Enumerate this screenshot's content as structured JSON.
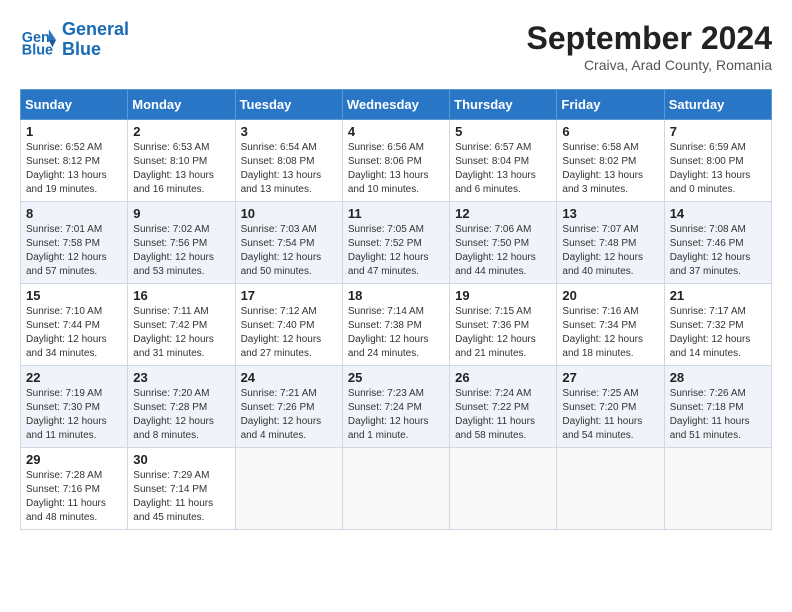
{
  "header": {
    "logo_line1": "General",
    "logo_line2": "Blue",
    "month": "September 2024",
    "location": "Craiva, Arad County, Romania"
  },
  "columns": [
    "Sunday",
    "Monday",
    "Tuesday",
    "Wednesday",
    "Thursday",
    "Friday",
    "Saturday"
  ],
  "weeks": [
    [
      {
        "day": 1,
        "sunrise": "6:52 AM",
        "sunset": "8:12 PM",
        "daylight": "13 hours and 19 minutes."
      },
      {
        "day": 2,
        "sunrise": "6:53 AM",
        "sunset": "8:10 PM",
        "daylight": "13 hours and 16 minutes."
      },
      {
        "day": 3,
        "sunrise": "6:54 AM",
        "sunset": "8:08 PM",
        "daylight": "13 hours and 13 minutes."
      },
      {
        "day": 4,
        "sunrise": "6:56 AM",
        "sunset": "8:06 PM",
        "daylight": "13 hours and 10 minutes."
      },
      {
        "day": 5,
        "sunrise": "6:57 AM",
        "sunset": "8:04 PM",
        "daylight": "13 hours and 6 minutes."
      },
      {
        "day": 6,
        "sunrise": "6:58 AM",
        "sunset": "8:02 PM",
        "daylight": "13 hours and 3 minutes."
      },
      {
        "day": 7,
        "sunrise": "6:59 AM",
        "sunset": "8:00 PM",
        "daylight": "13 hours and 0 minutes."
      }
    ],
    [
      {
        "day": 8,
        "sunrise": "7:01 AM",
        "sunset": "7:58 PM",
        "daylight": "12 hours and 57 minutes."
      },
      {
        "day": 9,
        "sunrise": "7:02 AM",
        "sunset": "7:56 PM",
        "daylight": "12 hours and 53 minutes."
      },
      {
        "day": 10,
        "sunrise": "7:03 AM",
        "sunset": "7:54 PM",
        "daylight": "12 hours and 50 minutes."
      },
      {
        "day": 11,
        "sunrise": "7:05 AM",
        "sunset": "7:52 PM",
        "daylight": "12 hours and 47 minutes."
      },
      {
        "day": 12,
        "sunrise": "7:06 AM",
        "sunset": "7:50 PM",
        "daylight": "12 hours and 44 minutes."
      },
      {
        "day": 13,
        "sunrise": "7:07 AM",
        "sunset": "7:48 PM",
        "daylight": "12 hours and 40 minutes."
      },
      {
        "day": 14,
        "sunrise": "7:08 AM",
        "sunset": "7:46 PM",
        "daylight": "12 hours and 37 minutes."
      }
    ],
    [
      {
        "day": 15,
        "sunrise": "7:10 AM",
        "sunset": "7:44 PM",
        "daylight": "12 hours and 34 minutes."
      },
      {
        "day": 16,
        "sunrise": "7:11 AM",
        "sunset": "7:42 PM",
        "daylight": "12 hours and 31 minutes."
      },
      {
        "day": 17,
        "sunrise": "7:12 AM",
        "sunset": "7:40 PM",
        "daylight": "12 hours and 27 minutes."
      },
      {
        "day": 18,
        "sunrise": "7:14 AM",
        "sunset": "7:38 PM",
        "daylight": "12 hours and 24 minutes."
      },
      {
        "day": 19,
        "sunrise": "7:15 AM",
        "sunset": "7:36 PM",
        "daylight": "12 hours and 21 minutes."
      },
      {
        "day": 20,
        "sunrise": "7:16 AM",
        "sunset": "7:34 PM",
        "daylight": "12 hours and 18 minutes."
      },
      {
        "day": 21,
        "sunrise": "7:17 AM",
        "sunset": "7:32 PM",
        "daylight": "12 hours and 14 minutes."
      }
    ],
    [
      {
        "day": 22,
        "sunrise": "7:19 AM",
        "sunset": "7:30 PM",
        "daylight": "12 hours and 11 minutes."
      },
      {
        "day": 23,
        "sunrise": "7:20 AM",
        "sunset": "7:28 PM",
        "daylight": "12 hours and 8 minutes."
      },
      {
        "day": 24,
        "sunrise": "7:21 AM",
        "sunset": "7:26 PM",
        "daylight": "12 hours and 4 minutes."
      },
      {
        "day": 25,
        "sunrise": "7:23 AM",
        "sunset": "7:24 PM",
        "daylight": "12 hours and 1 minute."
      },
      {
        "day": 26,
        "sunrise": "7:24 AM",
        "sunset": "7:22 PM",
        "daylight": "11 hours and 58 minutes."
      },
      {
        "day": 27,
        "sunrise": "7:25 AM",
        "sunset": "7:20 PM",
        "daylight": "11 hours and 54 minutes."
      },
      {
        "day": 28,
        "sunrise": "7:26 AM",
        "sunset": "7:18 PM",
        "daylight": "11 hours and 51 minutes."
      }
    ],
    [
      {
        "day": 29,
        "sunrise": "7:28 AM",
        "sunset": "7:16 PM",
        "daylight": "11 hours and 48 minutes."
      },
      {
        "day": 30,
        "sunrise": "7:29 AM",
        "sunset": "7:14 PM",
        "daylight": "11 hours and 45 minutes."
      },
      null,
      null,
      null,
      null,
      null
    ]
  ]
}
